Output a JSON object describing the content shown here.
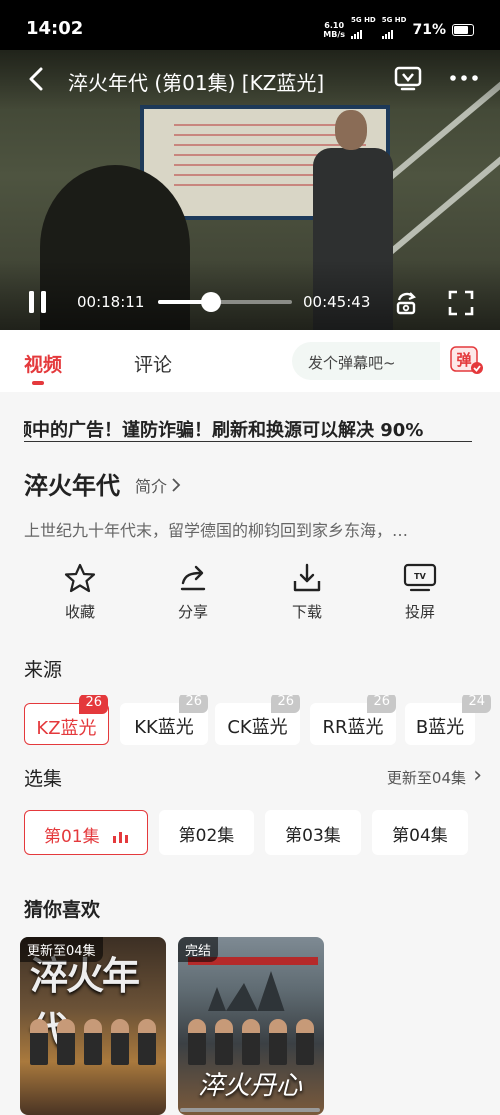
{
  "status": {
    "time": "14:02",
    "speed_value": "6.10",
    "speed_unit": "MB/s",
    "signal1": "5G HD",
    "signal2": "5G HD",
    "battery": "71%",
    "battery_level": 0.71
  },
  "player": {
    "title": "淬火年代 (第01集) [KZ蓝光]",
    "current_time": "00:18:11",
    "duration": "00:45:43",
    "progress": 0.398
  },
  "tabs": {
    "video": "视频",
    "comments": "评论"
  },
  "danmu": {
    "placeholder": "发个弹幕吧~",
    "button": "弹"
  },
  "notice": "频中的广告！谨防诈骗！刷新和换源可以解决 90%",
  "show": {
    "title": "淬火年代",
    "intro_link": "简介",
    "synopsis": "上世纪九十年代末，留学德国的柳钧回到家乡东海，…"
  },
  "actions": [
    {
      "label": "收藏",
      "icon": "star-icon"
    },
    {
      "label": "分享",
      "icon": "share-icon"
    },
    {
      "label": "下载",
      "icon": "download-icon"
    },
    {
      "label": "投屏",
      "icon": "tv-cast-icon"
    }
  ],
  "sources": {
    "title": "来源",
    "items": [
      {
        "label": "KZ蓝光",
        "count": "26",
        "active": true
      },
      {
        "label": "KK蓝光",
        "count": "26"
      },
      {
        "label": "CK蓝光",
        "count": "26"
      },
      {
        "label": "RR蓝光",
        "count": "26"
      },
      {
        "label": "B蓝光",
        "count": "24"
      }
    ]
  },
  "episodes": {
    "title": "选集",
    "update_link": "更新至04集",
    "items": [
      "第01集",
      "第02集",
      "第03集",
      "第04集"
    ]
  },
  "recommend": {
    "title": "猜你喜欢",
    "items": [
      {
        "tag": "更新至04集",
        "title_art": "淬火年代"
      },
      {
        "tag": "完结",
        "title_art": "淬火丹心"
      }
    ]
  },
  "colors": {
    "accent": "#e4393c"
  }
}
